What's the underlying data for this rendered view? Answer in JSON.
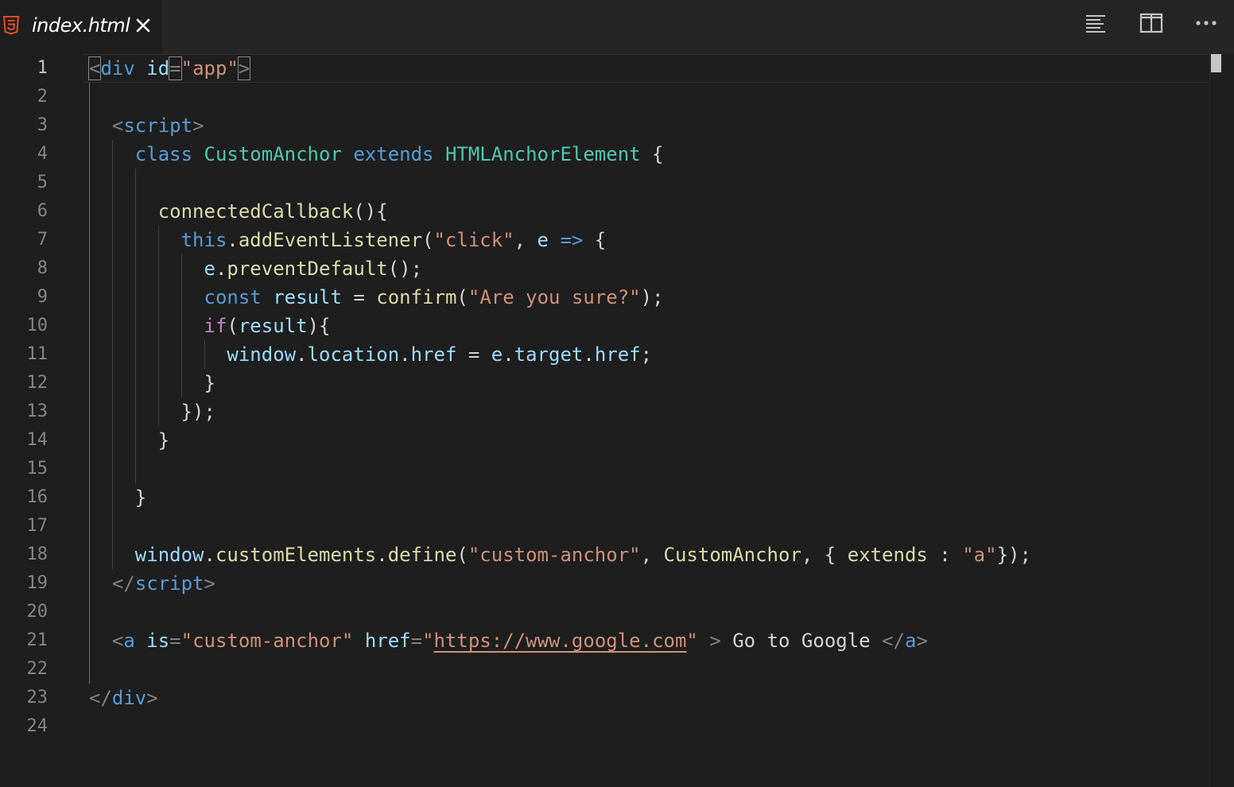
{
  "tab": {
    "title": "index.html",
    "icon": "html5-icon",
    "close": "close-icon"
  },
  "toolbar": {
    "buttons": [
      "open-preview-icon",
      "split-editor-icon",
      "more-actions-icon"
    ]
  },
  "colors": {
    "background": "#1e1e1e",
    "tabbar": "#252526",
    "line_number": "#858585",
    "tag": "#569cd6",
    "attribute": "#9cdcfe",
    "string": "#ce9178",
    "function": "#dcdcaa",
    "type": "#4ec9b0",
    "control": "#c586c0",
    "html5_orange": "#e44d26"
  },
  "editor": {
    "active_line": 1,
    "line_numbers": [
      "1",
      "2",
      "3",
      "4",
      "5",
      "6",
      "7",
      "8",
      "9",
      "10",
      "11",
      "12",
      "13",
      "14",
      "15",
      "16",
      "17",
      "18",
      "19",
      "20",
      "21",
      "22",
      "23",
      "24"
    ],
    "lines": [
      [
        [
          "punc",
          "<"
        ],
        [
          "tag",
          "div"
        ],
        [
          "def",
          " "
        ],
        [
          "attr",
          "id"
        ],
        [
          "punc",
          "="
        ],
        [
          "str",
          "\"app\""
        ],
        [
          "punc",
          ">"
        ]
      ],
      [],
      [
        [
          "def",
          "  "
        ],
        [
          "punc",
          "<"
        ],
        [
          "tag",
          "script"
        ],
        [
          "punc",
          ">"
        ]
      ],
      [
        [
          "def",
          "    "
        ],
        [
          "kw",
          "class"
        ],
        [
          "def",
          " "
        ],
        [
          "type",
          "CustomAnchor"
        ],
        [
          "def",
          " "
        ],
        [
          "kw",
          "extends"
        ],
        [
          "def",
          " "
        ],
        [
          "type",
          "HTMLAnchorElement"
        ],
        [
          "def",
          " {"
        ]
      ],
      [],
      [
        [
          "def",
          "      "
        ],
        [
          "fn",
          "connectedCallback"
        ],
        [
          "def",
          "(){"
        ]
      ],
      [
        [
          "def",
          "        "
        ],
        [
          "kw",
          "this"
        ],
        [
          "def",
          "."
        ],
        [
          "fn",
          "addEventListener"
        ],
        [
          "def",
          "("
        ],
        [
          "str",
          "\"click\""
        ],
        [
          "def",
          ", "
        ],
        [
          "var",
          "e"
        ],
        [
          "def",
          " "
        ],
        [
          "kw",
          "=>"
        ],
        [
          "def",
          " {"
        ]
      ],
      [
        [
          "def",
          "          "
        ],
        [
          "var",
          "e"
        ],
        [
          "def",
          "."
        ],
        [
          "fn",
          "preventDefault"
        ],
        [
          "def",
          "();"
        ]
      ],
      [
        [
          "def",
          "          "
        ],
        [
          "kw",
          "const"
        ],
        [
          "def",
          " "
        ],
        [
          "var",
          "result"
        ],
        [
          "def",
          " = "
        ],
        [
          "fn",
          "confirm"
        ],
        [
          "def",
          "("
        ],
        [
          "str",
          "\"Are you sure?\""
        ],
        [
          "def",
          ");"
        ]
      ],
      [
        [
          "def",
          "          "
        ],
        [
          "ctrl",
          "if"
        ],
        [
          "def",
          "("
        ],
        [
          "var",
          "result"
        ],
        [
          "def",
          "){"
        ]
      ],
      [
        [
          "def",
          "            "
        ],
        [
          "var",
          "window"
        ],
        [
          "def",
          "."
        ],
        [
          "var",
          "location"
        ],
        [
          "def",
          "."
        ],
        [
          "var",
          "href"
        ],
        [
          "def",
          " = "
        ],
        [
          "var",
          "e"
        ],
        [
          "def",
          "."
        ],
        [
          "var",
          "target"
        ],
        [
          "def",
          "."
        ],
        [
          "var",
          "href"
        ],
        [
          "def",
          ";"
        ]
      ],
      [
        [
          "def",
          "          }"
        ]
      ],
      [
        [
          "def",
          "        });"
        ]
      ],
      [
        [
          "def",
          "      }"
        ]
      ],
      [],
      [
        [
          "def",
          "    }"
        ]
      ],
      [],
      [
        [
          "def",
          "    "
        ],
        [
          "var",
          "window"
        ],
        [
          "def",
          "."
        ],
        [
          "fn",
          "customElements"
        ],
        [
          "def",
          "."
        ],
        [
          "fn",
          "define"
        ],
        [
          "def",
          "("
        ],
        [
          "str",
          "\"custom-anchor\""
        ],
        [
          "def",
          ", "
        ],
        [
          "fn",
          "CustomAnchor"
        ],
        [
          "def",
          ", { "
        ],
        [
          "fn",
          "extends"
        ],
        [
          "def",
          " : "
        ],
        [
          "str",
          "\"a\""
        ],
        [
          "def",
          "});"
        ]
      ],
      [
        [
          "def",
          "  "
        ],
        [
          "punc",
          "</"
        ],
        [
          "tag",
          "script"
        ],
        [
          "punc",
          ">"
        ]
      ],
      [],
      [
        [
          "def",
          "  "
        ],
        [
          "punc",
          "<"
        ],
        [
          "tag",
          "a"
        ],
        [
          "def",
          " "
        ],
        [
          "attr",
          "is"
        ],
        [
          "punc",
          "="
        ],
        [
          "str",
          "\"custom-anchor\""
        ],
        [
          "def",
          " "
        ],
        [
          "attr",
          "href"
        ],
        [
          "punc",
          "="
        ],
        [
          "str",
          "\""
        ],
        [
          "url",
          "https://www.google.com"
        ],
        [
          "str",
          "\""
        ],
        [
          "def",
          " "
        ],
        [
          "punc",
          ">"
        ],
        [
          "def",
          " Go to Google "
        ],
        [
          "punc",
          "</"
        ],
        [
          "tag",
          "a"
        ],
        [
          "punc",
          ">"
        ]
      ],
      [],
      [
        [
          "punc",
          "</"
        ],
        [
          "tag",
          "div"
        ],
        [
          "punc",
          ">"
        ]
      ],
      []
    ]
  }
}
